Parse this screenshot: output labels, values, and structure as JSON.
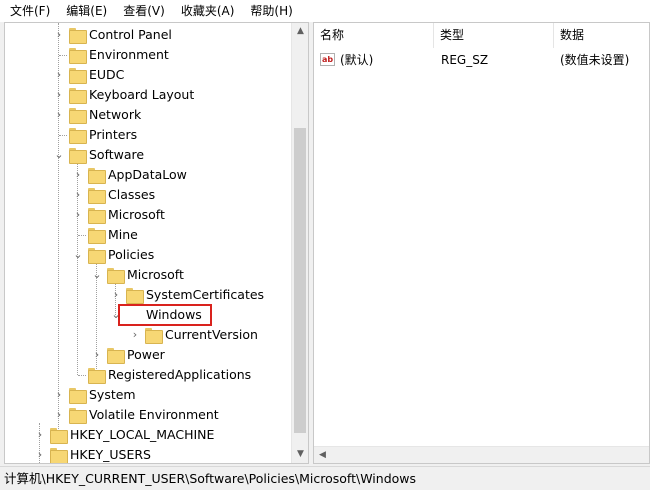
{
  "menubar": {
    "items": [
      "文件(F)",
      "编辑(E)",
      "查看(V)",
      "收藏夹(A)",
      "帮助(H)"
    ]
  },
  "tree": {
    "items": [
      {
        "label": "Control Panel",
        "expander": "›"
      },
      {
        "label": "Environment",
        "expander": ""
      },
      {
        "label": "EUDC",
        "expander": "›"
      },
      {
        "label": "Keyboard Layout",
        "expander": "›"
      },
      {
        "label": "Network",
        "expander": "›"
      },
      {
        "label": "Printers",
        "expander": ""
      },
      {
        "label": "Software",
        "expander": "⌄"
      },
      {
        "label": "AppDataLow",
        "expander": "›"
      },
      {
        "label": "Classes",
        "expander": "›"
      },
      {
        "label": "Microsoft",
        "expander": "›"
      },
      {
        "label": "Mine",
        "expander": ""
      },
      {
        "label": "Policies",
        "expander": "⌄"
      },
      {
        "label": "Microsoft",
        "expander": "⌄"
      },
      {
        "label": "SystemCertificates",
        "expander": "›"
      },
      {
        "label": "Windows",
        "expander": "⌄"
      },
      {
        "label": "CurrentVersion",
        "expander": "›"
      },
      {
        "label": "Power",
        "expander": "›"
      },
      {
        "label": "RegisteredApplications",
        "expander": ""
      },
      {
        "label": "System",
        "expander": "›"
      },
      {
        "label": "Volatile Environment",
        "expander": "›"
      },
      {
        "label": "HKEY_LOCAL_MACHINE",
        "expander": "›"
      },
      {
        "label": "HKEY_USERS",
        "expander": "›"
      }
    ]
  },
  "values": {
    "columns": [
      "名称",
      "类型",
      "数据"
    ],
    "rows": [
      {
        "icon": "ab",
        "name": "(默认)",
        "type": "REG_SZ",
        "data": "(数值未设置)"
      }
    ]
  },
  "status": {
    "path": "计算机\\HKEY_CURRENT_USER\\Software\\Policies\\Microsoft\\Windows"
  },
  "colors": {
    "folder": "#f7d774",
    "selection_box": "#d9221d"
  },
  "scroll": {
    "up_arrow": "▲",
    "down_arrow": "▼",
    "left_arrow": "◀"
  }
}
